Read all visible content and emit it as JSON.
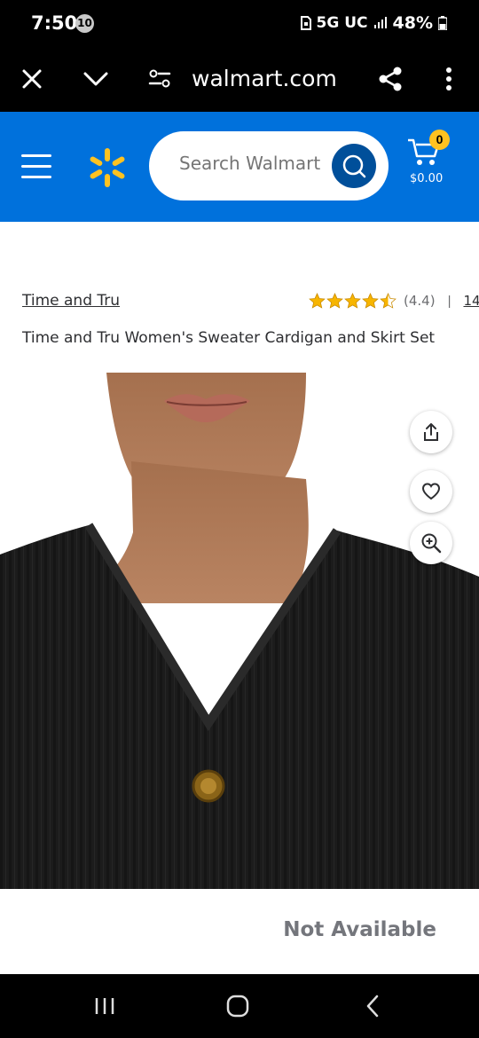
{
  "status_bar": {
    "time": "7:50",
    "notification_count": "10",
    "network": "5G UC",
    "battery": "48%"
  },
  "browser": {
    "url": "walmart.com",
    "icons": [
      "close-icon",
      "chevron-down-icon",
      "site-settings-icon",
      "share-icon",
      "more-vert-icon"
    ]
  },
  "header": {
    "search_placeholder": "Search Walmart",
    "cart_count": "0",
    "cart_total": "$0.00",
    "colors": {
      "brand_blue": "#0071dc",
      "spark_yellow": "#ffc220",
      "search_button": "#004f9a"
    }
  },
  "product": {
    "brand": "Time and Tru",
    "rating": 4.4,
    "rating_label": "(4.4)",
    "separator": "|",
    "review_count": "14",
    "title": "Time and Tru Women's Sweater Cardigan and Skirt Set",
    "availability": "Not Available"
  },
  "image_actions": [
    "share-icon",
    "heart-icon",
    "zoom-in-icon"
  ],
  "nav_bar": [
    "recent-apps-icon",
    "home-icon",
    "back-icon"
  ]
}
